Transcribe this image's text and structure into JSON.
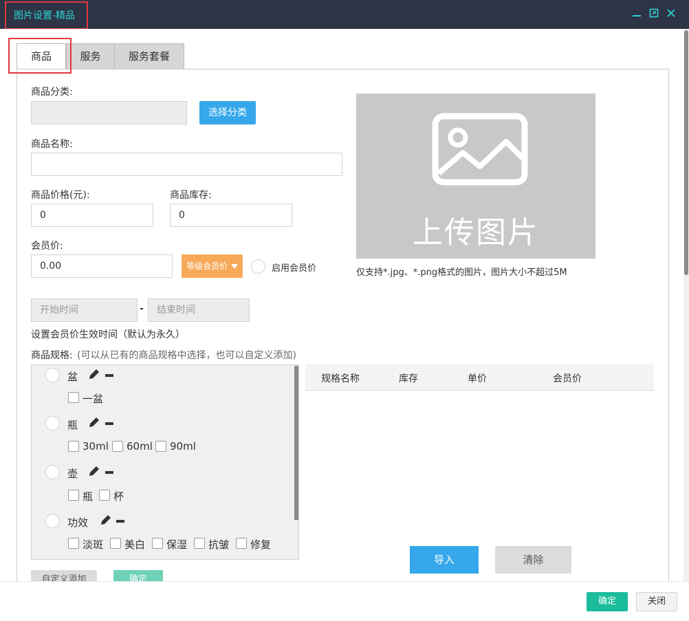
{
  "window": {
    "title": "图片设置-精品",
    "minimize_icon": "minimize-icon",
    "maximize_icon": "maximize-icon",
    "close_icon": "close-icon"
  },
  "tabs": [
    {
      "label": "商品",
      "active": true
    },
    {
      "label": "服务",
      "active": false
    },
    {
      "label": "服务套餐",
      "active": false
    }
  ],
  "form": {
    "category_label": "商品分类:",
    "category_value": "",
    "select_category_button": "选择分类",
    "name_label": "商品名称:",
    "name_value": "",
    "price_label": "商品价格(元):",
    "price_value": "0",
    "stock_label": "商品库存:",
    "stock_value": "0",
    "member_price_label": "会员价:",
    "member_price_value": "0.00",
    "grade_member_price_button": "等级会员价",
    "enable_member_price_label": "启用会员价",
    "start_time_placeholder": "开始时间",
    "time_separator": "-",
    "end_time_placeholder": "结束时间",
    "time_hint": "设置会员价生效时间（默认为永久）",
    "spec_label": "商品规格:",
    "spec_hint": "(可以从已有的商品规格中选择，也可以自定义添加)"
  },
  "upload": {
    "text": "上传图片",
    "hint": "仅支持*.jpg、*.png格式的图片，图片大小不超过5M",
    "icon": "image-icon"
  },
  "specs": [
    {
      "name": "盆",
      "options": [
        "一盆"
      ]
    },
    {
      "name": "瓶",
      "options": [
        "30ml",
        "60ml",
        "90ml"
      ]
    },
    {
      "name": "壶",
      "options": [
        "瓶",
        "杯"
      ]
    },
    {
      "name": "功效",
      "options": [
        "淡斑",
        "美白",
        "保湿",
        "抗皱",
        "修复"
      ]
    }
  ],
  "spec_table": {
    "headers": [
      "规格名称",
      "库存",
      "单价",
      "会员价"
    ]
  },
  "buttons": {
    "import": "导入",
    "clear": "清除",
    "custom_add": "自定义添加",
    "confirm_small": "确定",
    "ok": "确定",
    "close": "关闭"
  },
  "colors": {
    "titlebar": "#2d3446",
    "title_text": "#2fd2d2",
    "accent_blue": "#35a7ea",
    "accent_orange": "#f7a95a",
    "accent_green": "#1bbc9b",
    "highlight_red": "#e0393e"
  }
}
